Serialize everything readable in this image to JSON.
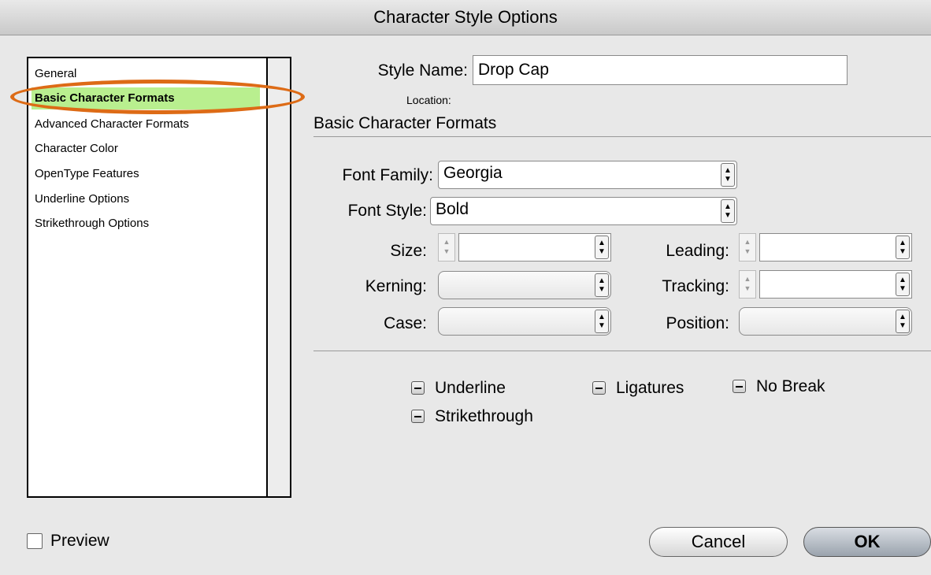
{
  "window": {
    "title": "Character Style Options"
  },
  "categories": [
    {
      "label": "General"
    },
    {
      "label": "Basic Character Formats"
    },
    {
      "label": "Advanced Character Formats"
    },
    {
      "label": "Character Color"
    },
    {
      "label": "OpenType Features"
    },
    {
      "label": "Underline Options"
    },
    {
      "label": "Strikethrough Options"
    }
  ],
  "selected_category": "Basic Character Formats",
  "highlight_color": "#dd6b16",
  "style_name": {
    "label": "Style Name:",
    "value": "Drop Cap"
  },
  "location": {
    "label": "Location:"
  },
  "section": {
    "title": "Basic Character Formats"
  },
  "fields": {
    "font_family": {
      "label": "Font Family:",
      "value": "Georgia"
    },
    "font_style": {
      "label": "Font Style:",
      "value": "Bold"
    },
    "size": {
      "label": "Size:",
      "value": ""
    },
    "leading": {
      "label": "Leading:",
      "value": ""
    },
    "kerning": {
      "label": "Kerning:",
      "value": ""
    },
    "tracking": {
      "label": "Tracking:",
      "value": ""
    },
    "case": {
      "label": "Case:",
      "value": ""
    },
    "position": {
      "label": "Position:",
      "value": ""
    }
  },
  "checkboxes": {
    "underline": {
      "label": "Underline",
      "state": "mixed"
    },
    "ligatures": {
      "label": "Ligatures",
      "state": "mixed"
    },
    "no_break": {
      "label": "No Break",
      "state": "mixed"
    },
    "strikethrough": {
      "label": "Strikethrough",
      "state": "mixed"
    }
  },
  "preview": {
    "label": "Preview",
    "checked": false
  },
  "buttons": {
    "cancel": "Cancel",
    "ok": "OK"
  }
}
